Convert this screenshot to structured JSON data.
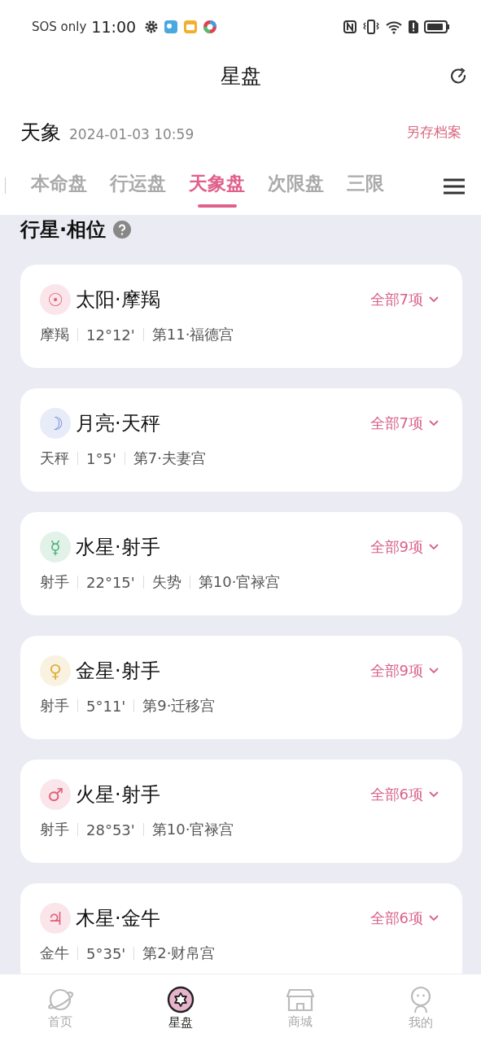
{
  "status_bar": {
    "carrier": "SOS only",
    "time": "11:00"
  },
  "header": {
    "title": "星盘"
  },
  "chart_info": {
    "name": "天象",
    "datetime": "2024-01-03 10:59",
    "save_link": "另存档案"
  },
  "tabs": [
    {
      "label": "本命盘",
      "selected": false
    },
    {
      "label": "行运盘",
      "selected": false
    },
    {
      "label": "天象盘",
      "selected": true
    },
    {
      "label": "次限盘",
      "selected": false
    },
    {
      "label": "三限",
      "selected": false
    }
  ],
  "section": {
    "title": "行星·相位"
  },
  "planets": [
    {
      "symbol": "☉",
      "color": "#e0607a",
      "title": "太阳·摩羯",
      "more": "全部7项",
      "meta": [
        "摩羯",
        "12°12'",
        "第11·福德宫"
      ]
    },
    {
      "symbol": "☽",
      "color": "#6a86d6",
      "title": "月亮·天秤",
      "more": "全部7项",
      "meta": [
        "天秤",
        "1°5'",
        "第7·夫妻宫"
      ]
    },
    {
      "symbol": "☿",
      "color": "#4caf78",
      "title": "水星·射手",
      "more": "全部9项",
      "meta": [
        "射手",
        "22°15'",
        "失势",
        "第10·官禄宫"
      ]
    },
    {
      "symbol": "♀",
      "color": "#e0b040",
      "title": "金星·射手",
      "more": "全部9项",
      "meta": [
        "射手",
        "5°11'",
        "第9·迁移宫"
      ]
    },
    {
      "symbol": "♂",
      "color": "#e0607a",
      "title": "火星·射手",
      "more": "全部6项",
      "meta": [
        "射手",
        "28°53'",
        "第10·官禄宫"
      ]
    },
    {
      "symbol": "♃",
      "color": "#e0607a",
      "title": "木星·金牛",
      "more": "全部6项",
      "meta": [
        "金牛",
        "5°35'",
        "第2·财帛宫"
      ]
    }
  ],
  "bottom_nav": [
    {
      "label": "首页",
      "kind": "planet",
      "selected": false
    },
    {
      "label": "星盘",
      "kind": "chart",
      "selected": true
    },
    {
      "label": "商城",
      "kind": "shop",
      "selected": false
    },
    {
      "label": "我的",
      "kind": "person",
      "selected": false
    }
  ]
}
